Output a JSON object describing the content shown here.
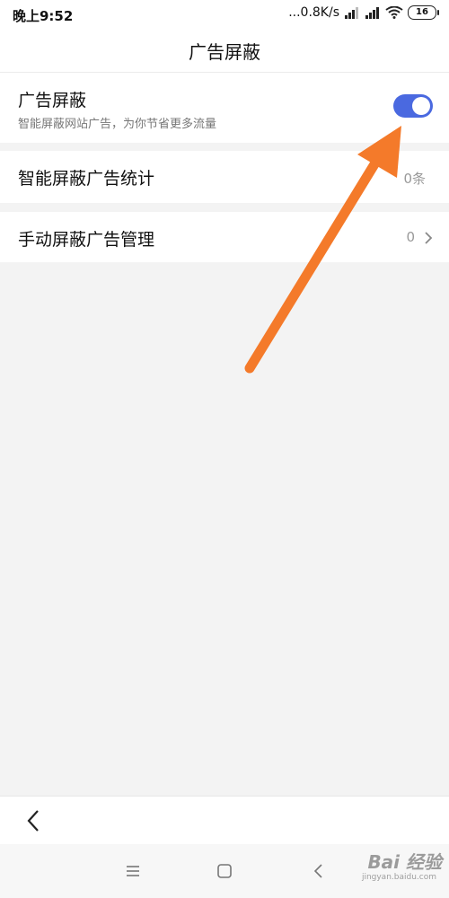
{
  "status_bar": {
    "time": "晚上9:52",
    "speed": "...0.8K/s",
    "battery": "16"
  },
  "header": {
    "title": "广告屏蔽"
  },
  "settings": {
    "toggle_row": {
      "title": "广告屏蔽",
      "subtitle": "智能屏蔽网站广告，为你节省更多流量",
      "enabled": true
    },
    "stats_row": {
      "title": "智能屏蔽广告统计",
      "value": "0条"
    },
    "manual_row": {
      "title": "手动屏蔽广告管理",
      "value": "0"
    }
  },
  "watermark": {
    "brand": "Bai 经验",
    "url": "jingyan.baidu.com"
  },
  "colors": {
    "accent": "#4a69e0",
    "annotation_arrow": "#f47a2a",
    "background": "#f3f3f3"
  }
}
